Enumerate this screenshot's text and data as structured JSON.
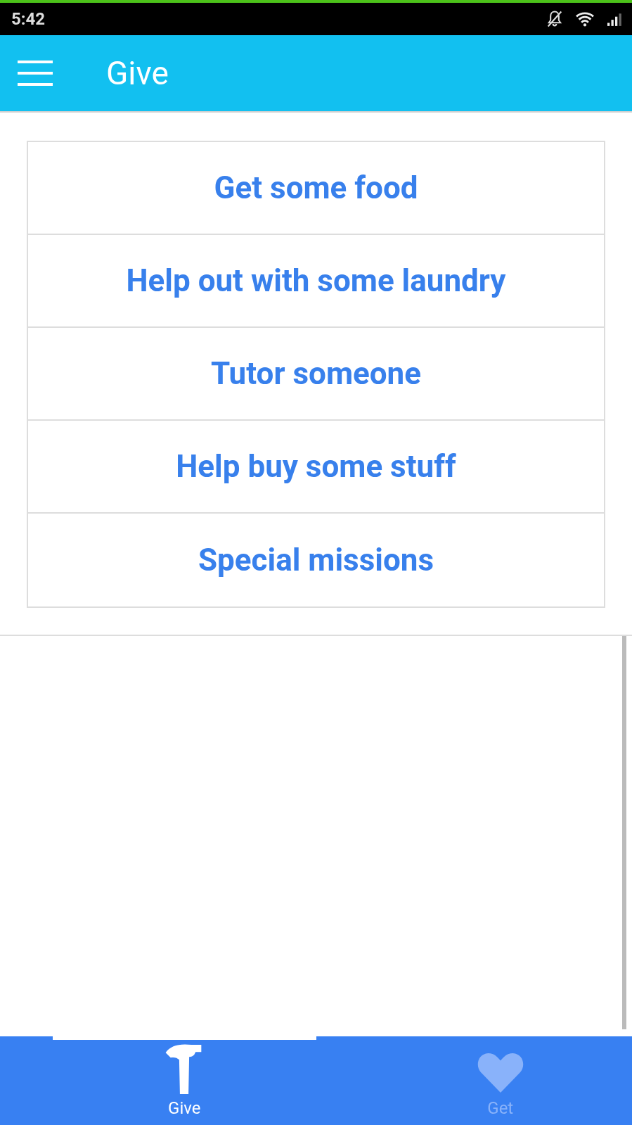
{
  "status_bar": {
    "time": "5:42"
  },
  "app_bar": {
    "title": "Give"
  },
  "options": [
    {
      "label": "Get some food"
    },
    {
      "label": "Help out with some laundry"
    },
    {
      "label": "Tutor someone"
    },
    {
      "label": "Help buy some stuff"
    },
    {
      "label": "Special missions"
    }
  ],
  "bottom_tabs": [
    {
      "label": "Give",
      "selected": true
    },
    {
      "label": "Get",
      "selected": false
    }
  ]
}
